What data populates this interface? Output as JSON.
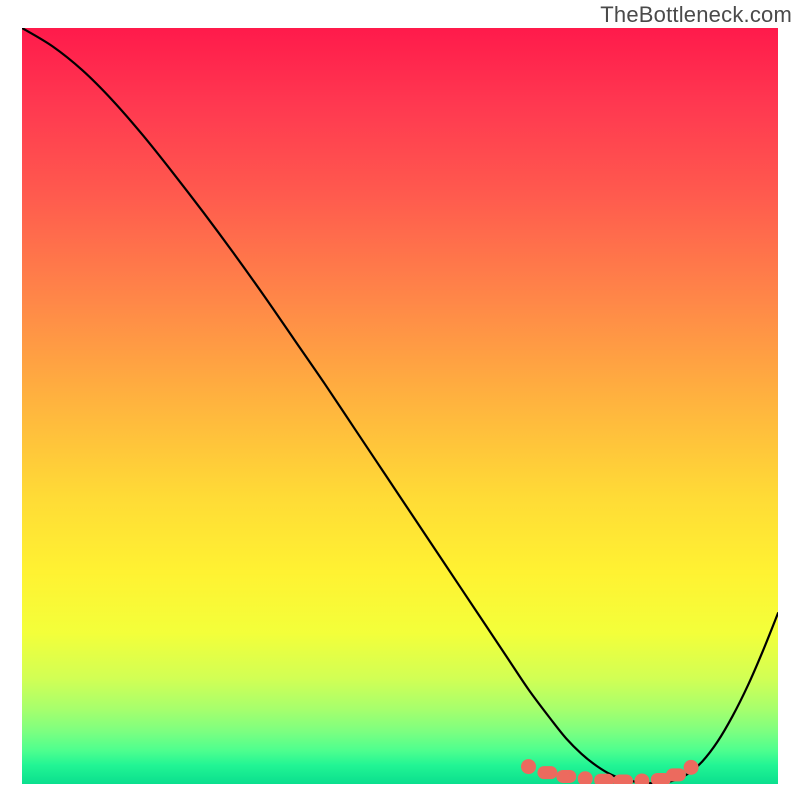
{
  "watermark": "TheBottleneck.com",
  "chart_data": {
    "type": "line",
    "title": "",
    "xlabel": "",
    "ylabel": "",
    "xlim": [
      0,
      100
    ],
    "ylim": [
      0,
      100
    ],
    "grid": false,
    "legend": false,
    "series": [
      {
        "name": "bottleneck-curve",
        "x": [
          0,
          4,
          8,
          12,
          16,
          20,
          24,
          28,
          32,
          36,
          40,
          44,
          48,
          52,
          56,
          60,
          64,
          67,
          70,
          72,
          74,
          76,
          78,
          80,
          82,
          84,
          86,
          88,
          90,
          92,
          94,
          96,
          98,
          100
        ],
        "y": [
          100,
          97.6,
          94.4,
          90.4,
          85.8,
          80.8,
          75.6,
          70.2,
          64.6,
          58.8,
          53.0,
          47.0,
          41.0,
          35.0,
          29.0,
          23.0,
          17.0,
          12.5,
          8.5,
          6.0,
          4.0,
          2.4,
          1.2,
          0.5,
          0.2,
          0.1,
          0.4,
          1.3,
          3.0,
          5.6,
          9.0,
          13.0,
          17.6,
          22.6
        ],
        "comment": "y is bottleneck percentage; curve falls from 100% at x=0, reaches ~0 around x≈82-86, rises again toward the right"
      }
    ],
    "markers": {
      "name": "optimal-range-dots",
      "x": [
        67,
        69.5,
        72,
        74.5,
        77,
        79.5,
        82,
        84.5,
        86.5,
        88.5
      ],
      "y": [
        2.3,
        1.5,
        1.0,
        0.7,
        0.5,
        0.4,
        0.4,
        0.6,
        1.2,
        2.2
      ],
      "style": "salmon-rounded"
    },
    "background_gradient": {
      "stops": [
        {
          "offset": 0.0,
          "color": "#ff1a4b"
        },
        {
          "offset": 0.1,
          "color": "#ff3850"
        },
        {
          "offset": 0.22,
          "color": "#ff5a4e"
        },
        {
          "offset": 0.36,
          "color": "#ff8748"
        },
        {
          "offset": 0.5,
          "color": "#ffb53e"
        },
        {
          "offset": 0.62,
          "color": "#ffdb36"
        },
        {
          "offset": 0.72,
          "color": "#fff232"
        },
        {
          "offset": 0.8,
          "color": "#f3ff3a"
        },
        {
          "offset": 0.86,
          "color": "#d2ff54"
        },
        {
          "offset": 0.9,
          "color": "#a8ff6c"
        },
        {
          "offset": 0.93,
          "color": "#7dff80"
        },
        {
          "offset": 0.955,
          "color": "#4fff8e"
        },
        {
          "offset": 0.975,
          "color": "#22f594"
        },
        {
          "offset": 1.0,
          "color": "#0adf8e"
        }
      ]
    }
  }
}
